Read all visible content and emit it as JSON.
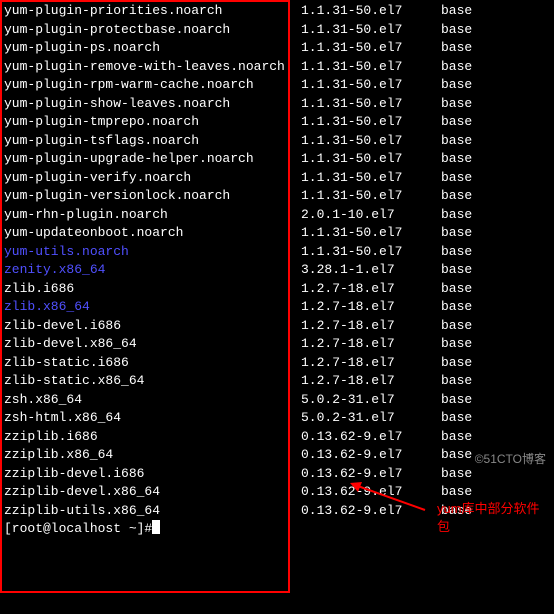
{
  "packages": [
    {
      "name": "yum-plugin-priorities.noarch",
      "version": "1.1.31-50.el7",
      "repo": "base",
      "blue": false
    },
    {
      "name": "yum-plugin-protectbase.noarch",
      "version": "1.1.31-50.el7",
      "repo": "base",
      "blue": false
    },
    {
      "name": "yum-plugin-ps.noarch",
      "version": "1.1.31-50.el7",
      "repo": "base",
      "blue": false
    },
    {
      "name": "yum-plugin-remove-with-leaves.noarch",
      "version": "1.1.31-50.el7",
      "repo": "base",
      "blue": false
    },
    {
      "name": "yum-plugin-rpm-warm-cache.noarch",
      "version": "1.1.31-50.el7",
      "repo": "base",
      "blue": false
    },
    {
      "name": "yum-plugin-show-leaves.noarch",
      "version": "1.1.31-50.el7",
      "repo": "base",
      "blue": false
    },
    {
      "name": "yum-plugin-tmprepo.noarch",
      "version": "1.1.31-50.el7",
      "repo": "base",
      "blue": false
    },
    {
      "name": "yum-plugin-tsflags.noarch",
      "version": "1.1.31-50.el7",
      "repo": "base",
      "blue": false
    },
    {
      "name": "yum-plugin-upgrade-helper.noarch",
      "version": "1.1.31-50.el7",
      "repo": "base",
      "blue": false
    },
    {
      "name": "yum-plugin-verify.noarch",
      "version": "1.1.31-50.el7",
      "repo": "base",
      "blue": false
    },
    {
      "name": "yum-plugin-versionlock.noarch",
      "version": "1.1.31-50.el7",
      "repo": "base",
      "blue": false
    },
    {
      "name": "yum-rhn-plugin.noarch",
      "version": "2.0.1-10.el7",
      "repo": "base",
      "blue": false
    },
    {
      "name": "yum-updateonboot.noarch",
      "version": "1.1.31-50.el7",
      "repo": "base",
      "blue": false
    },
    {
      "name": "yum-utils.noarch",
      "version": "1.1.31-50.el7",
      "repo": "base",
      "blue": true
    },
    {
      "name": "zenity.x86_64",
      "version": "3.28.1-1.el7",
      "repo": "base",
      "blue": true
    },
    {
      "name": "zlib.i686",
      "version": "1.2.7-18.el7",
      "repo": "base",
      "blue": false
    },
    {
      "name": "zlib.x86_64",
      "version": "1.2.7-18.el7",
      "repo": "base",
      "blue": true
    },
    {
      "name": "zlib-devel.i686",
      "version": "1.2.7-18.el7",
      "repo": "base",
      "blue": false
    },
    {
      "name": "zlib-devel.x86_64",
      "version": "1.2.7-18.el7",
      "repo": "base",
      "blue": false
    },
    {
      "name": "zlib-static.i686",
      "version": "1.2.7-18.el7",
      "repo": "base",
      "blue": false
    },
    {
      "name": "zlib-static.x86_64",
      "version": "1.2.7-18.el7",
      "repo": "base",
      "blue": false
    },
    {
      "name": "zsh.x86_64",
      "version": "5.0.2-31.el7",
      "repo": "base",
      "blue": false
    },
    {
      "name": "zsh-html.x86_64",
      "version": "5.0.2-31.el7",
      "repo": "base",
      "blue": false
    },
    {
      "name": "zziplib.i686",
      "version": "0.13.62-9.el7",
      "repo": "base",
      "blue": false
    },
    {
      "name": "zziplib.x86_64",
      "version": "0.13.62-9.el7",
      "repo": "base",
      "blue": false
    },
    {
      "name": "zziplib-devel.i686",
      "version": "0.13.62-9.el7",
      "repo": "base",
      "blue": false
    },
    {
      "name": "zziplib-devel.x86_64",
      "version": "0.13.62-9.el7",
      "repo": "base",
      "blue": false
    },
    {
      "name": "zziplib-utils.x86_64",
      "version": "0.13.62-9.el7",
      "repo": "base",
      "blue": false
    }
  ],
  "prompt": {
    "user_host": "[root@localhost ~]# ",
    "command": ""
  },
  "annotation": "yum库中部分软件包",
  "watermark": "©51CTO博客"
}
